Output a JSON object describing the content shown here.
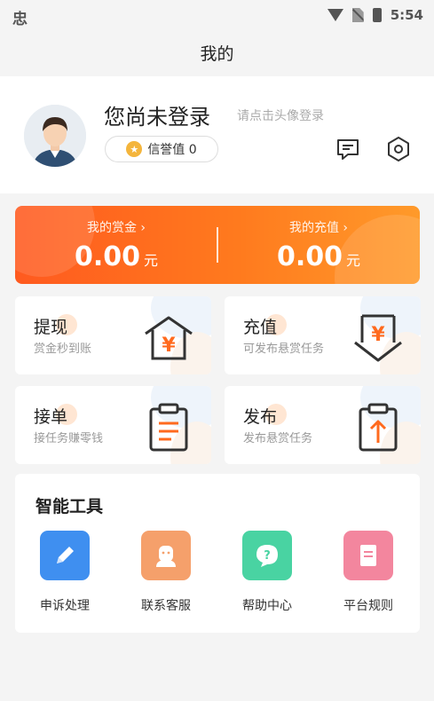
{
  "status_bar": {
    "carrier_glyph": "忠",
    "time": "5:54"
  },
  "header": {
    "title": "我的"
  },
  "profile": {
    "name": "您尚未登录",
    "hint": "请点击头像登录",
    "credit_label": "信誉值 0"
  },
  "wallet": {
    "bounty_label": "我的赏金 ›",
    "bounty_amount": "0.00",
    "bounty_unit": "元",
    "recharge_label": "我的充值 ›",
    "recharge_amount": "0.00",
    "recharge_unit": "元"
  },
  "cards": [
    {
      "title": "提现",
      "subtitle": "赏金秒到账",
      "icon": "withdraw-icon"
    },
    {
      "title": "充值",
      "subtitle": "可发布悬赏任务",
      "icon": "recharge-icon"
    },
    {
      "title": "接单",
      "subtitle": "接任务赚零钱",
      "icon": "accept-order-icon"
    },
    {
      "title": "发布",
      "subtitle": "发布悬赏任务",
      "icon": "publish-icon"
    }
  ],
  "tools": {
    "title": "智能工具",
    "items": [
      {
        "label": "申诉处理",
        "icon": "pencil-icon",
        "color": "#3f8ff0"
      },
      {
        "label": "联系客服",
        "icon": "customer-service-icon",
        "color": "#f5a06b"
      },
      {
        "label": "帮助中心",
        "icon": "help-icon",
        "color": "#49d3a2"
      },
      {
        "label": "平台规则",
        "icon": "rules-icon",
        "color": "#f3869e"
      }
    ]
  },
  "colors": {
    "accent": "#ff6a1e",
    "icon_stroke": "#333333",
    "yen_orange": "#ff6a1e"
  }
}
